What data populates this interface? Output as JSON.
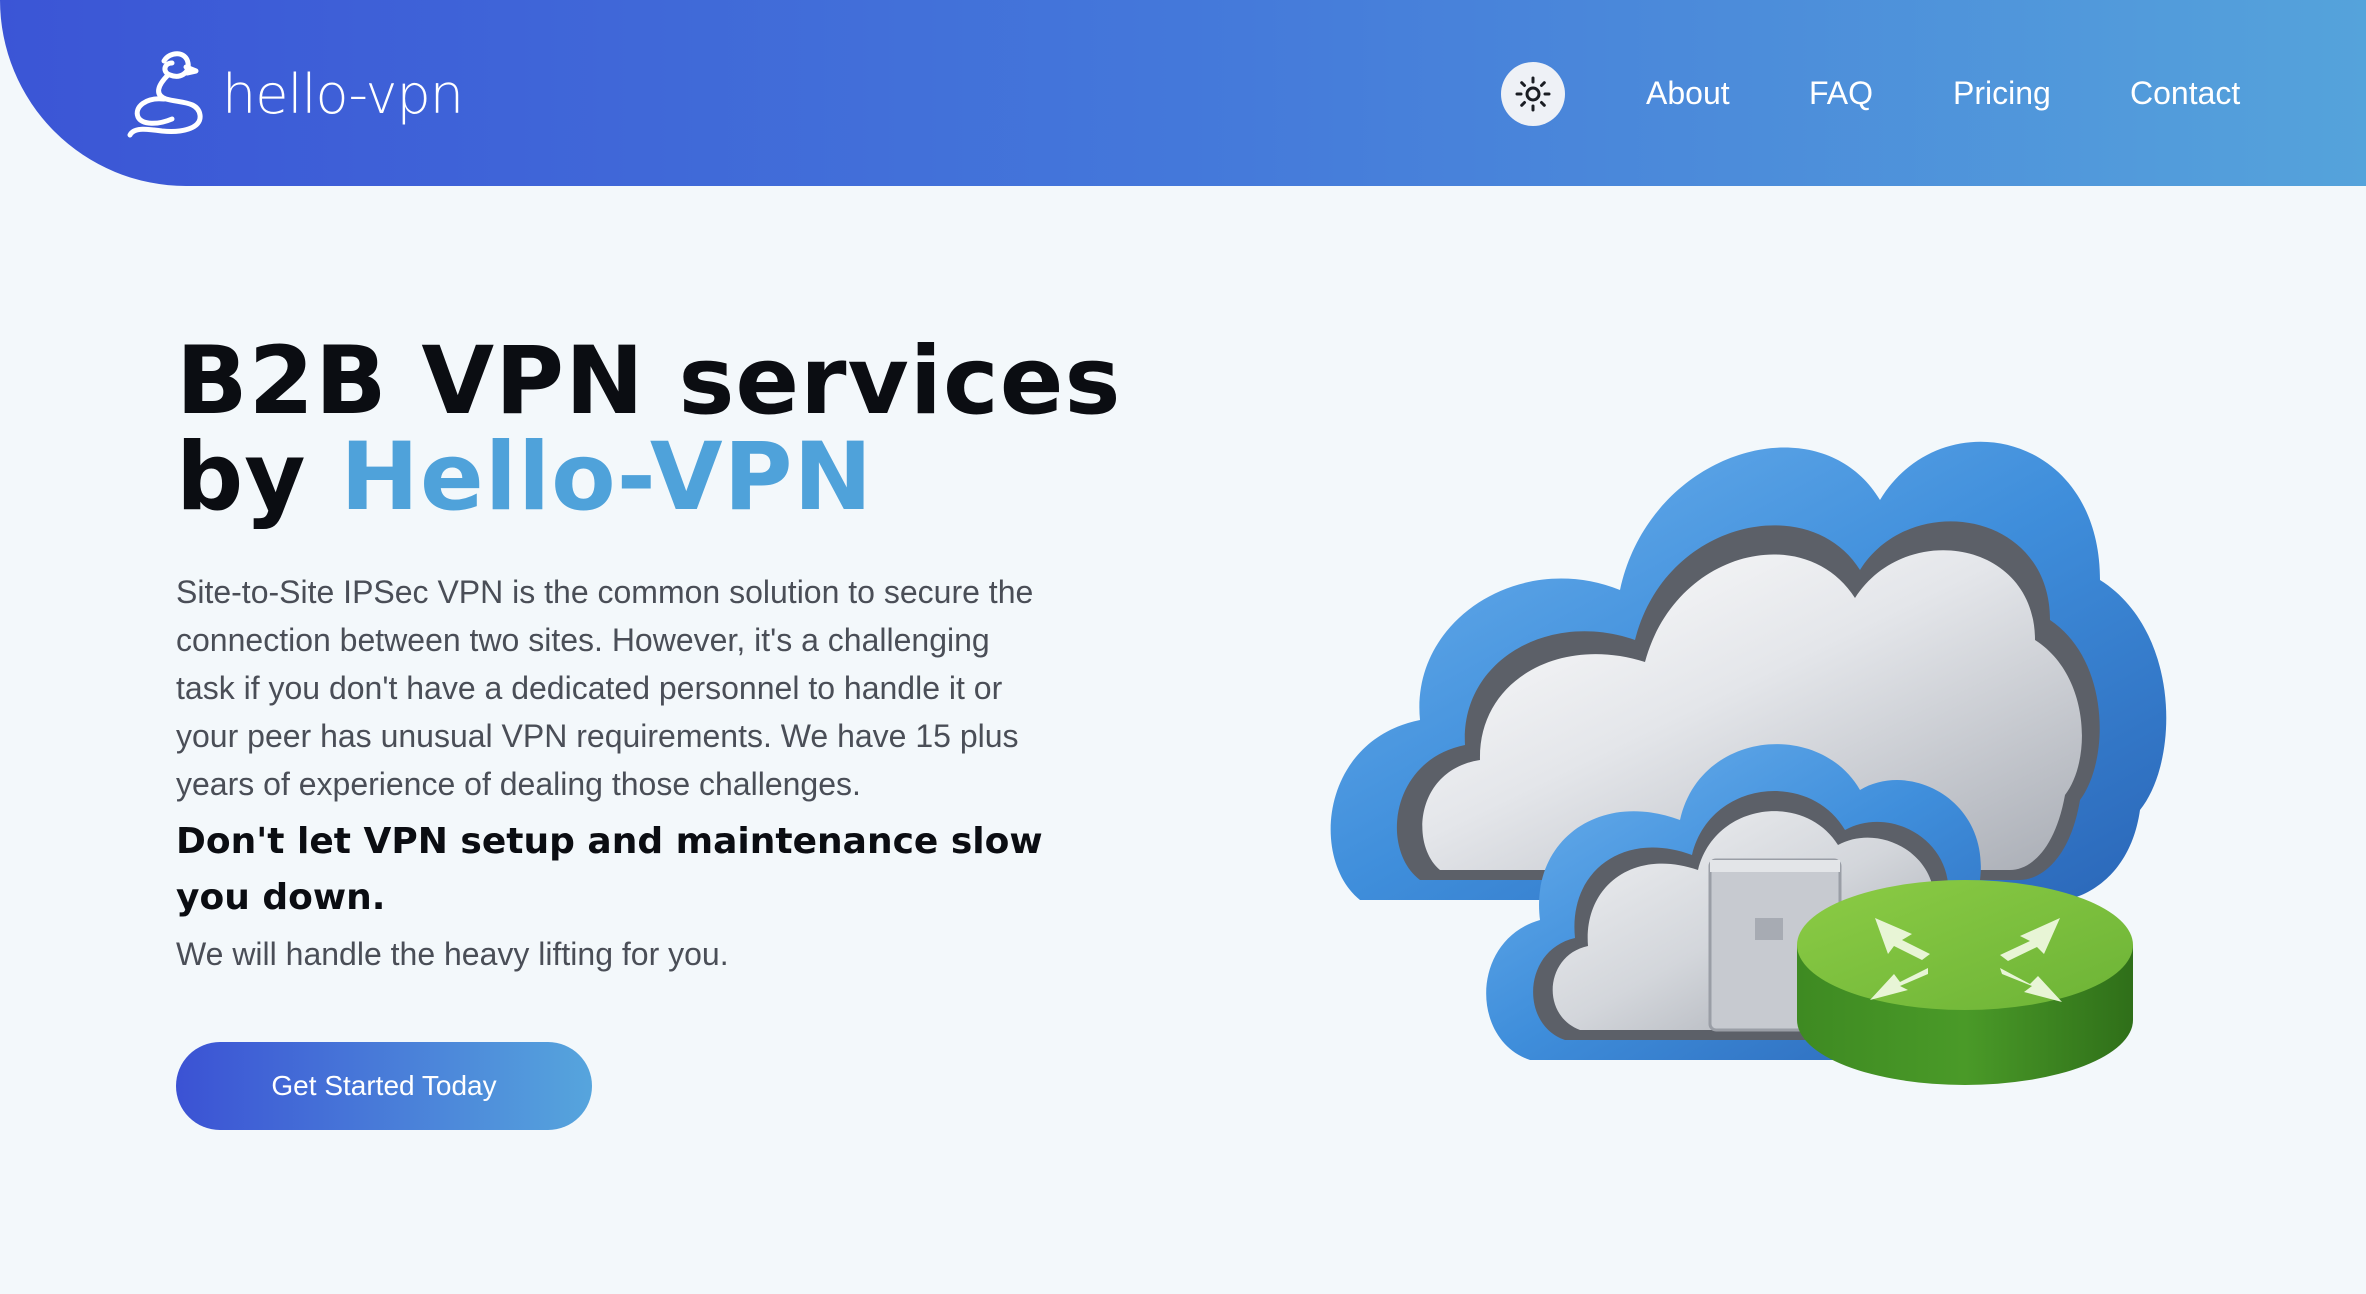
{
  "header": {
    "brand_name": "hello-vpn",
    "logo_icon": "swan-icon",
    "theme_icon": "sun-icon",
    "nav": [
      {
        "label": "About"
      },
      {
        "label": "FAQ"
      },
      {
        "label": "Pricing"
      },
      {
        "label": "Contact"
      }
    ],
    "gradient_start": "#3b55d6",
    "gradient_end": "#55a3db"
  },
  "hero": {
    "title_line1": "B2B VPN services",
    "title_by": "by ",
    "title_accent": "Hello-VPN",
    "description": "Site-to-Site IPSec VPN is the common solution to secure the connection between two sites. However, it's a challenging task if you don't have a dedicated personnel to handle it or your peer has unusual VPN requirements. We have 15 plus years of experience of dealing those challenges.",
    "emphasis": "Don't let VPN setup and maintenance slow you down.",
    "subtext": "We will handle the heavy lifting for you.",
    "cta_label": "Get Started Today",
    "accent_color": "#4fa2da"
  },
  "illustration": {
    "icon": "cloud-router-icon",
    "cloud_color": "#3f8edb",
    "router_color": "#5aab2e"
  }
}
